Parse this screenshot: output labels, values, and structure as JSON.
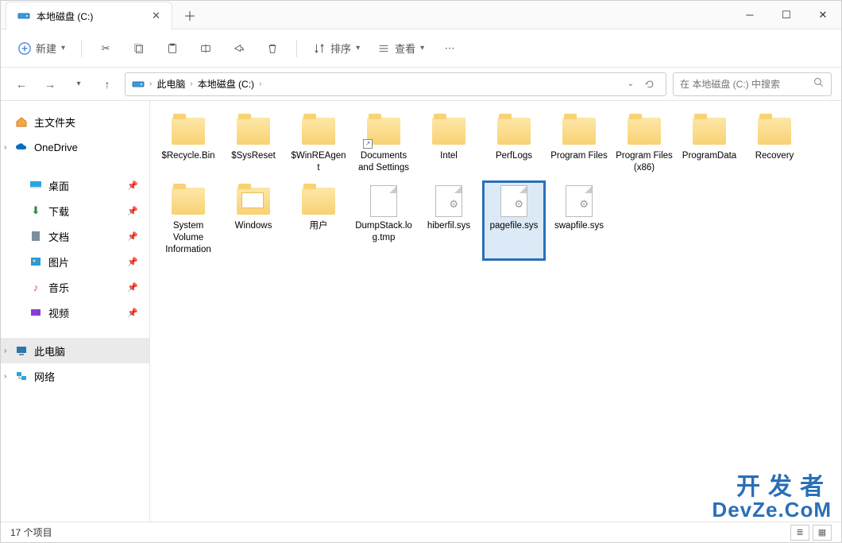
{
  "tab_title": "本地磁盘 (C:)",
  "new_btn_label": "新建",
  "sort_label": "排序",
  "view_label": "查看",
  "breadcrumb": {
    "root_label": "此电脑",
    "current_label": "本地磁盘 (C:)"
  },
  "search_placeholder": "在 本地磁盘 (C:) 中搜索",
  "sidebar": {
    "home": "主文件夹",
    "onedrive": "OneDrive",
    "desktop": "桌面",
    "downloads": "下载",
    "documents": "文档",
    "pictures": "图片",
    "music": "音乐",
    "videos": "视频",
    "thispc": "此电脑",
    "network": "网络"
  },
  "items": [
    {
      "name": "$Recycle.Bin",
      "type": "folder"
    },
    {
      "name": "$SysReset",
      "type": "folder"
    },
    {
      "name": "$WinREAgent",
      "type": "folder"
    },
    {
      "name": "Documents and Settings",
      "type": "folder",
      "shortcut": true
    },
    {
      "name": "Intel",
      "type": "folder"
    },
    {
      "name": "PerfLogs",
      "type": "folder"
    },
    {
      "name": "Program Files",
      "type": "folder"
    },
    {
      "name": "Program Files (x86)",
      "type": "folder"
    },
    {
      "name": "ProgramData",
      "type": "folder"
    },
    {
      "name": "Recovery",
      "type": "folder"
    },
    {
      "name": "System Volume Information",
      "type": "folder"
    },
    {
      "name": "Windows",
      "type": "folder-open"
    },
    {
      "name": "用户",
      "type": "folder"
    },
    {
      "name": "DumpStack.log.tmp",
      "type": "file"
    },
    {
      "name": "hiberfil.sys",
      "type": "sysfile"
    },
    {
      "name": "pagefile.sys",
      "type": "sysfile",
      "selected": true
    },
    {
      "name": "swapfile.sys",
      "type": "sysfile"
    }
  ],
  "status_text": "17 个项目",
  "watermark": {
    "line1": "开发者",
    "line2": "DevZe.CoM"
  },
  "colors": {
    "accent": "#2a6fb7"
  }
}
